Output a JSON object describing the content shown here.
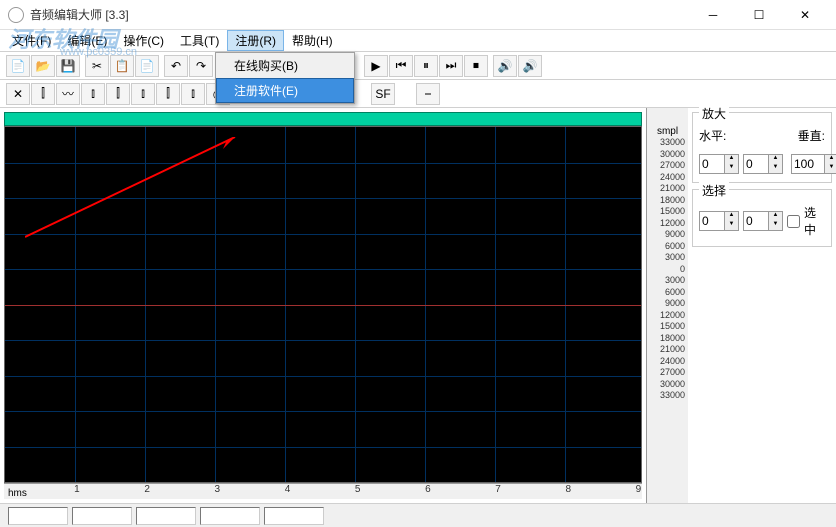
{
  "window": {
    "title": "音频编辑大师  [3.3]"
  },
  "menubar": {
    "items": [
      {
        "label": "文件(F)"
      },
      {
        "label": "编辑(E)"
      },
      {
        "label": "操作(C)"
      },
      {
        "label": "工具(T)"
      },
      {
        "label": "注册(R)"
      },
      {
        "label": "帮助(H)"
      }
    ]
  },
  "dropdown": {
    "items": [
      {
        "label": "在线购买(B)"
      },
      {
        "label": "注册软件(E)"
      }
    ]
  },
  "ruler": {
    "title": "smpl",
    "values": [
      "33000",
      "30000",
      "27000",
      "24000",
      "21000",
      "18000",
      "15000",
      "12000",
      "9000",
      "6000",
      "3000",
      "0",
      "3000",
      "6000",
      "9000",
      "12000",
      "15000",
      "18000",
      "21000",
      "24000",
      "27000",
      "30000",
      "33000"
    ]
  },
  "time_ruler": {
    "unit": "hms",
    "ticks": [
      "1",
      "2",
      "3",
      "4",
      "5",
      "6",
      "7",
      "8",
      "9"
    ]
  },
  "panels": {
    "zoom": {
      "title": "放大",
      "horiz_label": "水平:",
      "horiz_value": "0",
      "horiz_value2": "0",
      "vert_label": "垂直:",
      "vert_value": "100"
    },
    "select": {
      "title": "选择",
      "val1": "0",
      "val2": "0",
      "checkbox_label": "选中"
    }
  },
  "watermark": {
    "text": "河东软件园",
    "url": "www.pc0359.cn"
  }
}
